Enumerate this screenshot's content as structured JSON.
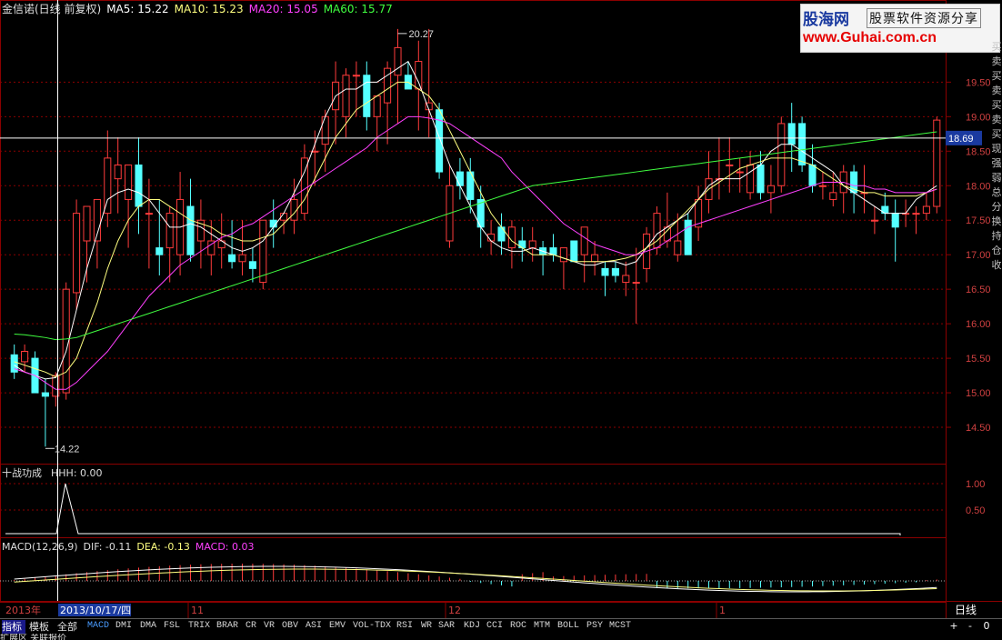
{
  "title_bar": {
    "name": "金信诺(日线 前复权)",
    "ma5": "MA5: 15.22",
    "ma10": "MA10: 15.23",
    "ma20": "MA20: 15.05",
    "ma60": "MA60: 15.77"
  },
  "price_axis_labels": [
    "19.50",
    "19.00",
    "18.50",
    "18.00",
    "17.50",
    "17.00",
    "16.50",
    "16.00",
    "15.50",
    "15.00",
    "14.50"
  ],
  "cursor_price": "18.69",
  "high_label": "20.27",
  "low_label": "14.22",
  "sub1": {
    "title": "十战功成",
    "value": "HHH: 0.00",
    "axis": [
      "1.00",
      "0.50"
    ]
  },
  "sub2": {
    "title": "MACD(12,26,9)",
    "dif": "DIF: -0.11",
    "dea": "DEA: -0.13",
    "macd": "MACD: 0.03"
  },
  "date_axis": {
    "year": "2013年",
    "cursor_date": "2013/10/17/四",
    "months": [
      "11",
      "12",
      "1"
    ],
    "period": "日线"
  },
  "tabs": [
    "指标",
    "模板",
    "全部"
  ],
  "indicators": [
    "MACD",
    "DMI",
    "DMA",
    "FSL",
    "TRIX",
    "BRAR",
    "CR",
    "VR",
    "OBV",
    "ASI",
    "EMV",
    "VOL-TDX",
    "RSI",
    "WR",
    "SAR",
    "KDJ",
    "CCI",
    "ROC",
    "MTM",
    "BOLL",
    "PSY",
    "MCST"
  ],
  "controls": [
    "+",
    "-",
    "0"
  ],
  "status_bar": "扩展区    关联报价",
  "side_strip": [
    "买",
    "卖",
    "买",
    "卖",
    "买",
    "卖",
    "买",
    "现",
    "强",
    "弱",
    "总",
    "分",
    "换",
    "持",
    "仓",
    "收"
  ],
  "logo": {
    "line1": "股海网",
    "line1b": "股票软件资源分享",
    "line2": "www.Guhai.com.cn"
  },
  "colors": {
    "up": "#ff3b3b",
    "down": "#54ffff",
    "ma5": "#ffffff",
    "ma10": "#ffff80",
    "ma20": "#ff40ff",
    "ma60": "#40ff40",
    "grid": "#8b0000"
  },
  "chart_data": {
    "type": "candlestick",
    "y_range": [
      14.0,
      20.4
    ],
    "candles": [
      [
        15.55,
        15.7,
        15.2,
        15.3
      ],
      [
        15.45,
        15.7,
        15.3,
        15.6
      ],
      [
        15.5,
        15.6,
        15.0,
        15.0
      ],
      [
        15.0,
        15.2,
        14.22,
        14.95
      ],
      [
        14.95,
        15.3,
        14.8,
        15.25
      ],
      [
        15.0,
        16.6,
        14.9,
        16.5
      ],
      [
        16.45,
        17.8,
        16.2,
        17.6
      ],
      [
        17.2,
        17.7,
        16.6,
        17.7
      ],
      [
        17.2,
        17.8,
        16.8,
        17.8
      ],
      [
        17.6,
        18.8,
        17.4,
        18.4
      ],
      [
        18.1,
        18.7,
        17.6,
        18.3
      ],
      [
        17.8,
        18.3,
        17.1,
        18.3
      ],
      [
        18.3,
        18.7,
        17.3,
        17.7
      ],
      [
        17.6,
        18.1,
        16.8,
        17.6
      ],
      [
        17.1,
        17.8,
        16.7,
        17.0
      ],
      [
        17.1,
        17.7,
        16.6,
        17.6
      ],
      [
        17.0,
        18.2,
        16.7,
        17.8
      ],
      [
        17.7,
        18.1,
        16.9,
        17.0
      ],
      [
        17.2,
        17.8,
        16.8,
        17.5
      ],
      [
        17.0,
        17.5,
        16.7,
        17.2
      ],
      [
        17.1,
        17.6,
        16.8,
        17.2
      ],
      [
        17.0,
        17.5,
        16.8,
        16.9
      ],
      [
        16.9,
        17.5,
        16.7,
        17.0
      ],
      [
        16.9,
        17.1,
        16.6,
        16.8
      ],
      [
        16.6,
        17.5,
        16.5,
        17.5
      ],
      [
        17.5,
        17.8,
        17.1,
        17.4
      ],
      [
        17.5,
        17.6,
        17.3,
        17.6
      ],
      [
        17.5,
        18.1,
        17.3,
        17.8
      ],
      [
        17.6,
        18.6,
        17.5,
        18.4
      ],
      [
        18.5,
        18.8,
        18.0,
        18.5
      ],
      [
        18.6,
        19.1,
        18.2,
        19.0
      ],
      [
        19.1,
        19.8,
        18.6,
        19.5
      ],
      [
        19.0,
        19.7,
        18.7,
        19.6
      ],
      [
        19.6,
        19.8,
        19.0,
        19.6
      ],
      [
        19.6,
        19.8,
        18.8,
        19.0
      ],
      [
        19.0,
        19.3,
        18.5,
        19.3
      ],
      [
        19.2,
        19.8,
        18.6,
        19.7
      ],
      [
        19.6,
        20.27,
        18.9,
        20.0
      ],
      [
        19.6,
        19.8,
        19.4,
        19.4
      ],
      [
        19.4,
        20.1,
        18.8,
        19.8
      ],
      [
        19.1,
        20.27,
        18.7,
        19.2
      ],
      [
        19.1,
        19.2,
        18.1,
        18.2
      ],
      [
        17.2,
        18.3,
        17.1,
        18.0
      ],
      [
        18.2,
        18.4,
        17.8,
        18.0
      ],
      [
        18.2,
        18.4,
        17.6,
        17.8
      ],
      [
        17.8,
        18.0,
        17.1,
        17.4
      ],
      [
        17.2,
        17.5,
        17.0,
        17.3
      ],
      [
        17.4,
        17.6,
        17.0,
        17.2
      ],
      [
        17.1,
        17.5,
        16.8,
        17.4
      ],
      [
        17.2,
        17.4,
        16.9,
        17.1
      ],
      [
        17.1,
        17.4,
        16.9,
        17.2
      ],
      [
        17.1,
        17.2,
        16.7,
        17.0
      ],
      [
        17.1,
        17.3,
        16.9,
        17.0
      ],
      [
        16.9,
        17.1,
        16.5,
        17.1
      ],
      [
        17.2,
        17.2,
        16.9,
        16.9
      ],
      [
        17.0,
        17.4,
        16.6,
        17.4
      ],
      [
        16.9,
        17.2,
        16.7,
        17.0
      ],
      [
        16.8,
        16.9,
        16.4,
        16.7
      ],
      [
        16.8,
        16.9,
        16.6,
        16.7
      ],
      [
        16.6,
        16.9,
        16.4,
        16.7
      ],
      [
        16.6,
        17.1,
        16.0,
        16.6
      ],
      [
        16.8,
        17.4,
        16.6,
        17.3
      ],
      [
        17.1,
        17.7,
        17.0,
        17.6
      ],
      [
        17.2,
        17.9,
        17.1,
        17.4
      ],
      [
        17.0,
        17.6,
        16.9,
        17.2
      ],
      [
        17.5,
        17.6,
        17.0,
        17.0
      ],
      [
        17.4,
        18.0,
        17.2,
        17.8
      ],
      [
        17.8,
        18.5,
        17.6,
        18.1
      ],
      [
        18.1,
        18.7,
        17.8,
        18.1
      ],
      [
        18.3,
        18.7,
        17.9,
        18.3
      ],
      [
        18.2,
        18.4,
        17.9,
        18.2
      ],
      [
        17.9,
        18.5,
        17.8,
        18.3
      ],
      [
        18.3,
        18.5,
        17.8,
        17.9
      ],
      [
        17.9,
        18.3,
        17.6,
        18.0
      ],
      [
        18.0,
        19.0,
        17.9,
        18.9
      ],
      [
        18.9,
        19.2,
        18.2,
        18.6
      ],
      [
        18.9,
        19.0,
        18.2,
        18.3
      ],
      [
        18.3,
        18.6,
        17.9,
        18.0
      ],
      [
        18.0,
        18.2,
        17.8,
        18.0
      ],
      [
        17.8,
        18.2,
        17.7,
        17.9
      ],
      [
        17.9,
        18.3,
        17.6,
        18.2
      ],
      [
        18.2,
        18.3,
        17.6,
        17.9
      ],
      [
        17.9,
        18.3,
        17.6,
        17.9
      ],
      [
        17.5,
        17.7,
        17.3,
        17.5
      ],
      [
        17.7,
        17.9,
        17.5,
        17.6
      ],
      [
        17.6,
        17.8,
        16.9,
        17.4
      ],
      [
        17.6,
        17.8,
        17.4,
        17.6
      ],
      [
        17.6,
        17.7,
        17.3,
        17.6
      ],
      [
        17.6,
        17.9,
        17.5,
        17.7
      ],
      [
        17.7,
        19.0,
        17.6,
        18.95
      ]
    ],
    "ma_lines": {
      "ma5": [
        15.4,
        15.3,
        15.25,
        15.2,
        15.22,
        15.6,
        16.2,
        16.8,
        17.3,
        17.8,
        17.9,
        17.95,
        17.9,
        17.8,
        17.6,
        17.4,
        17.4,
        17.45,
        17.4,
        17.3,
        17.2,
        17.1,
        17.05,
        17.1,
        17.2,
        17.4,
        17.6,
        17.9,
        18.2,
        18.6,
        19.0,
        19.3,
        19.4,
        19.4,
        19.5,
        19.5,
        19.6,
        19.7,
        19.8,
        19.5,
        19.1,
        18.7,
        18.3,
        18.0,
        17.7,
        17.4,
        17.2,
        17.1,
        17.05,
        17.05,
        17.1,
        17.05,
        17.0,
        16.95,
        16.9,
        16.85,
        16.85,
        16.9,
        16.9,
        16.85,
        16.9,
        17.1,
        17.3,
        17.4,
        17.5,
        17.6,
        17.8,
        18.0,
        18.1,
        18.1,
        18.1,
        18.2,
        18.3,
        18.5,
        18.6,
        18.6,
        18.5,
        18.4,
        18.3,
        18.2,
        18.0,
        17.9,
        17.8,
        17.7,
        17.6,
        17.6,
        17.6,
        17.8,
        17.9,
        18.0
      ],
      "ma10": [
        15.45,
        15.4,
        15.35,
        15.3,
        15.23,
        15.3,
        15.5,
        15.9,
        16.3,
        16.8,
        17.2,
        17.5,
        17.7,
        17.8,
        17.8,
        17.7,
        17.6,
        17.5,
        17.45,
        17.4,
        17.3,
        17.25,
        17.2,
        17.2,
        17.25,
        17.3,
        17.45,
        17.6,
        17.8,
        18.1,
        18.4,
        18.7,
        18.9,
        19.1,
        19.2,
        19.3,
        19.4,
        19.5,
        19.5,
        19.4,
        19.3,
        19.1,
        18.8,
        18.5,
        18.2,
        17.9,
        17.6,
        17.4,
        17.2,
        17.1,
        17.0,
        17.0,
        17.0,
        16.95,
        16.9,
        16.9,
        16.9,
        16.9,
        16.92,
        16.95,
        17.0,
        17.1,
        17.2,
        17.35,
        17.5,
        17.65,
        17.8,
        17.95,
        18.05,
        18.15,
        18.25,
        18.3,
        18.35,
        18.4,
        18.4,
        18.4,
        18.35,
        18.3,
        18.2,
        18.1,
        18.0,
        17.95,
        17.9,
        17.9,
        17.85,
        17.85,
        17.85,
        17.85,
        17.9,
        17.95
      ],
      "ma20": [
        15.35,
        15.3,
        15.25,
        15.15,
        15.05,
        15.05,
        15.15,
        15.3,
        15.45,
        15.6,
        15.8,
        16.0,
        16.2,
        16.4,
        16.55,
        16.7,
        16.85,
        16.95,
        17.05,
        17.15,
        17.25,
        17.3,
        17.4,
        17.45,
        17.55,
        17.65,
        17.75,
        17.85,
        17.95,
        18.05,
        18.15,
        18.25,
        18.35,
        18.45,
        18.55,
        18.7,
        18.8,
        18.9,
        19.0,
        19.0,
        18.98,
        18.95,
        18.9,
        18.8,
        18.7,
        18.6,
        18.5,
        18.4,
        18.2,
        18.05,
        17.9,
        17.75,
        17.6,
        17.45,
        17.35,
        17.25,
        17.15,
        17.1,
        17.05,
        17.0,
        17.0,
        17.05,
        17.1,
        17.2,
        17.3,
        17.4,
        17.45,
        17.5,
        17.55,
        17.6,
        17.65,
        17.7,
        17.75,
        17.8,
        17.85,
        17.9,
        17.95,
        18.0,
        18.05,
        18.05,
        18.05,
        18.0,
        18.0,
        17.95,
        17.95,
        17.9,
        17.9,
        17.9,
        17.9,
        17.95
      ],
      "ma60": [
        15.85,
        15.84,
        15.82,
        15.8,
        15.77,
        15.78,
        15.8,
        15.85,
        15.9,
        15.95,
        16.0,
        16.05,
        16.1,
        16.15,
        16.2,
        16.25,
        16.3,
        16.35,
        16.4,
        16.45,
        16.5,
        16.55,
        16.6,
        16.65,
        16.7,
        16.75,
        16.8,
        16.85,
        16.9,
        16.95,
        17.0,
        17.05,
        17.1,
        17.15,
        17.2,
        17.25,
        17.3,
        17.35,
        17.4,
        17.45,
        17.5,
        17.55,
        17.6,
        17.65,
        17.7,
        17.75,
        17.8,
        17.85,
        17.9,
        17.95,
        18.0,
        18.02,
        18.04,
        18.06,
        18.08,
        18.1,
        18.12,
        18.14,
        18.16,
        18.18,
        18.2,
        18.22,
        18.24,
        18.26,
        18.28,
        18.3,
        18.32,
        18.34,
        18.36,
        18.38,
        18.4,
        18.42,
        18.44,
        18.46,
        18.48,
        18.5,
        18.52,
        18.54,
        18.56,
        18.58,
        18.6,
        18.62,
        18.64,
        18.66,
        18.68,
        18.7,
        18.72,
        18.74,
        18.76,
        18.78
      ]
    }
  }
}
